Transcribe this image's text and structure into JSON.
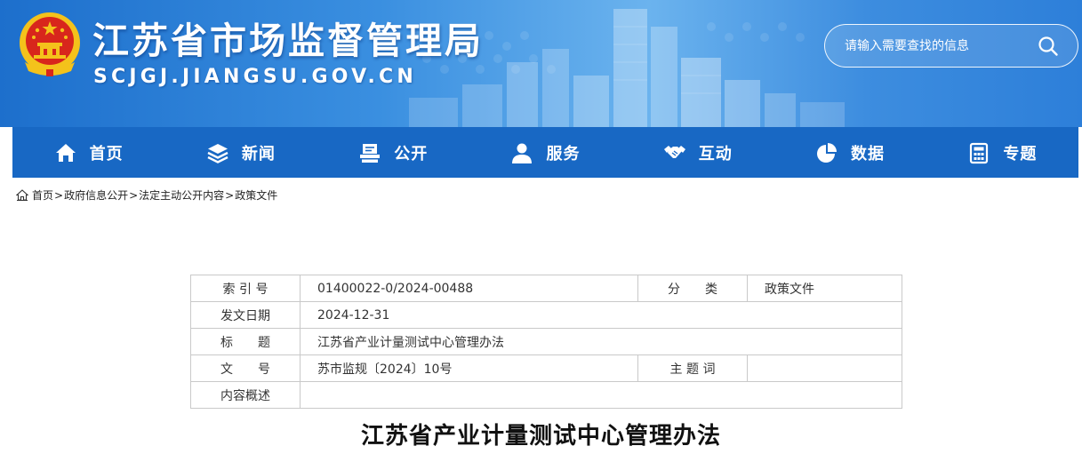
{
  "header": {
    "site_title": "江苏省市场监督管理局",
    "site_domain": "SCJGJ.JIANGSU.GOV.CN",
    "search_placeholder": "请输入需要查找的信息"
  },
  "nav": {
    "items": [
      {
        "label": "首页",
        "icon": "home-icon"
      },
      {
        "label": "新闻",
        "icon": "layers-icon"
      },
      {
        "label": "公开",
        "icon": "document-stack-icon"
      },
      {
        "label": "服务",
        "icon": "user-service-icon"
      },
      {
        "label": "互动",
        "icon": "handshake-icon"
      },
      {
        "label": "数据",
        "icon": "pie-chart-icon"
      },
      {
        "label": "专题",
        "icon": "calculator-icon"
      }
    ]
  },
  "breadcrumb": {
    "items": [
      "首页",
      "政府信息公开",
      "法定主动公开内容",
      "政策文件"
    ],
    "separator": ">"
  },
  "info": {
    "index_label": "索 引 号",
    "index_value": "01400022-0/2024-00488",
    "category_label": "分　　类",
    "category_value": "政策文件",
    "date_label": "发文日期",
    "date_value": "2024-12-31",
    "title_label": "标　　题",
    "title_value": "江苏省产业计量测试中心管理办法",
    "docno_label": "文　　号",
    "docno_value": "苏市监规〔2024〕10号",
    "subject_label": "主 题 词",
    "subject_value": "",
    "summary_label": "内容概述",
    "summary_value": ""
  },
  "document": {
    "title": "江苏省产业计量测试中心管理办法"
  },
  "colors": {
    "nav_bg": "#1868c4",
    "banner_blue": "#2d7fd9",
    "table_border": "#c9c9c9"
  }
}
